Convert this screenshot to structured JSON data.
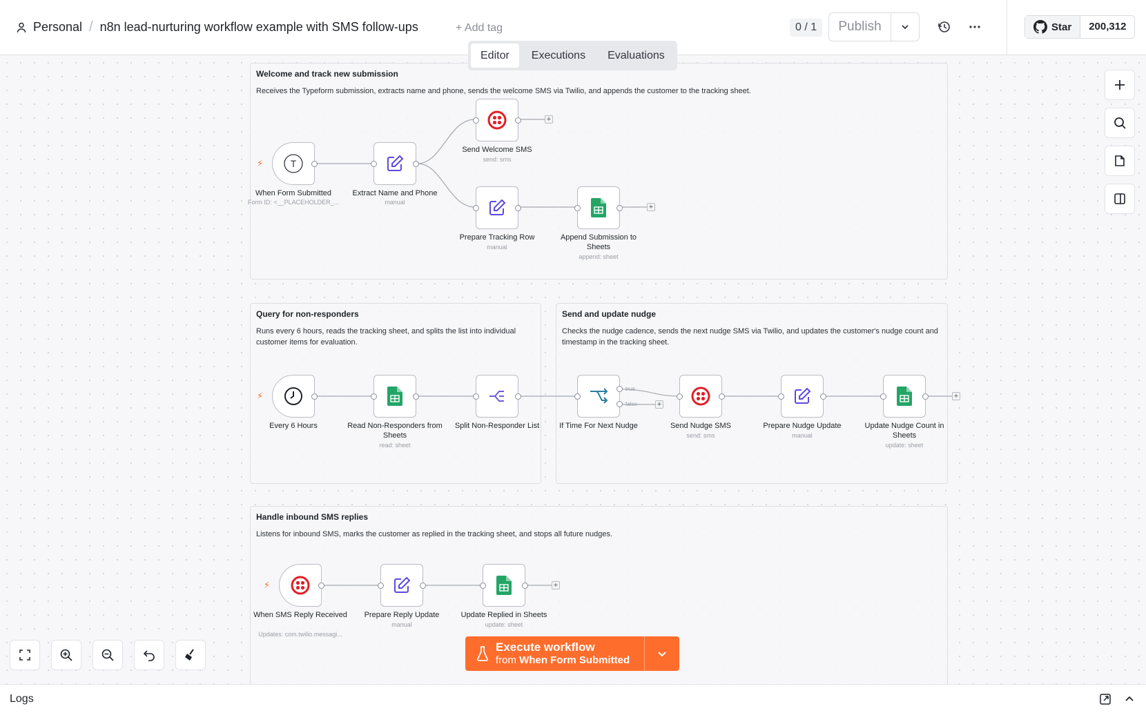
{
  "header": {
    "breadcrumb_project": "Personal",
    "breadcrumb_sep": "/",
    "workflow_title": "n8n lead-nurturing workflow example with SMS follow-ups",
    "add_tag": "+ Add tag",
    "version_counter": "0 / 1",
    "publish_label": "Publish",
    "github_star_label": "Star",
    "github_star_count": "200,312"
  },
  "tabs": [
    {
      "label": "Editor",
      "active": true
    },
    {
      "label": "Executions",
      "active": false
    },
    {
      "label": "Evaluations",
      "active": false
    }
  ],
  "sections": {
    "welcome": {
      "title": "Welcome and track new submission",
      "description": "Receives the Typeform submission, extracts name and phone, sends the welcome SMS via Twilio, and appends the customer to the tracking sheet."
    },
    "query": {
      "title": "Query for non-responders",
      "description": "Runs every 6 hours, reads the tracking sheet, and splits the list into individual customer items for evaluation."
    },
    "nudge": {
      "title": "Send and update nudge",
      "description": "Checks the nudge cadence, sends the next nudge SMS via Twilio, and updates the customer's nudge count and timestamp in the tracking sheet."
    },
    "inbound": {
      "title": "Handle inbound SMS replies",
      "description": "Listens for inbound SMS, marks the customer as replied in the tracking sheet, and stops all future nudges."
    }
  },
  "nodes": {
    "form": {
      "label": "When Form Submitted",
      "sub": "Form ID: <__PLACEHOLDER_...",
      "icon": "typeform-icon"
    },
    "extract": {
      "label": "Extract Name and Phone",
      "sub": "manual",
      "icon": "edit-icon"
    },
    "welcome_sms": {
      "label": "Send Welcome SMS",
      "sub": "send: sms",
      "icon": "twilio-icon"
    },
    "tracking_row": {
      "label": "Prepare Tracking Row",
      "sub": "manual",
      "icon": "edit-icon"
    },
    "append_sheets": {
      "label": "Append Submission to Sheets",
      "sub": "append: sheet",
      "icon": "sheets-icon"
    },
    "every6": {
      "label": "Every 6 Hours",
      "sub": "",
      "icon": "clock-icon"
    },
    "read_nonresp": {
      "label": "Read Non-Responders from Sheets",
      "sub": "read: sheet",
      "icon": "sheets-icon"
    },
    "split": {
      "label": "Split Non-Responder List",
      "sub": "",
      "icon": "split-icon"
    },
    "if_time": {
      "label": "If Time For Next Nudge",
      "sub": "",
      "icon": "if-icon",
      "branch_true": "true",
      "branch_false": "false"
    },
    "nudge_sms": {
      "label": "Send Nudge SMS",
      "sub": "send: sms",
      "icon": "twilio-icon"
    },
    "prep_nudge": {
      "label": "Prepare Nudge Update",
      "sub": "manual",
      "icon": "edit-icon"
    },
    "update_nudge": {
      "label": "Update Nudge Count in Sheets",
      "sub": "update: sheet",
      "icon": "sheets-icon"
    },
    "sms_reply": {
      "label": "When SMS Reply Received",
      "sub": "Updates: com.twilio.messagi...",
      "icon": "twilio-icon"
    },
    "prep_reply": {
      "label": "Prepare Reply Update",
      "sub": "manual",
      "icon": "edit-icon"
    },
    "update_replied": {
      "label": "Update Replied in Sheets",
      "sub": "update: sheet",
      "icon": "sheets-icon"
    }
  },
  "execute": {
    "label": "Execute workflow",
    "from_prefix": "from",
    "from_node": "When Form Submitted"
  },
  "logs_label": "Logs",
  "colors": {
    "accent": "#ff6d2d",
    "twilio": "#e31e26",
    "sheets": "#23a566",
    "edit": "#5a49e0",
    "split": "#6b5be2",
    "if": "#2b7fa0"
  }
}
